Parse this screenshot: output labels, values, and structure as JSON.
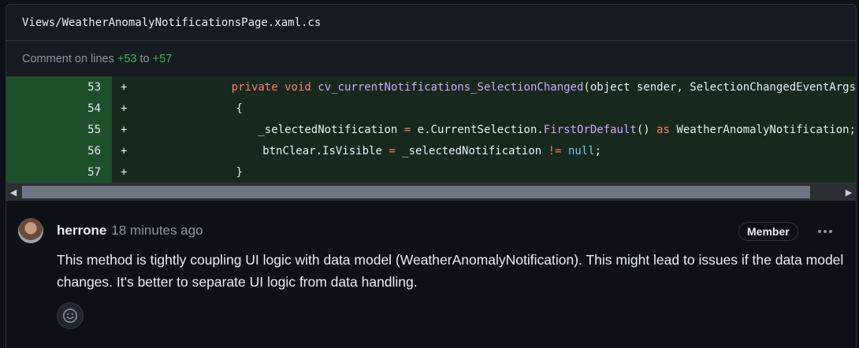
{
  "file": {
    "path": "Views/WeatherAnomalyNotificationsPage.xaml.cs"
  },
  "comment_range": {
    "prefix": "Comment on lines",
    "start": "+53",
    "joiner": "to",
    "end": "+57"
  },
  "diff": {
    "lines": [
      {
        "number": "53",
        "marker": "+"
      },
      {
        "number": "54",
        "marker": "+"
      },
      {
        "number": "55",
        "marker": "+"
      },
      {
        "number": "56",
        "marker": "+"
      },
      {
        "number": "57",
        "marker": "+"
      }
    ],
    "code": {
      "l53": {
        "indent": "        ",
        "kw1": "private",
        "sp1": " ",
        "t1": "void",
        "sp2": " ",
        "fn": "cv_currentNotifications_SelectionChanged",
        "rest": "(object sender, SelectionChangedEventArgs"
      },
      "l54": {
        "indent": "        ",
        "text": "{"
      },
      "l55": {
        "indent": "            ",
        "a": "_selectedNotification ",
        "op": "=",
        "b": " e.CurrentSelection.",
        "fn": "FirstOrDefault",
        "c": "() ",
        "kw": "as",
        "d": " WeatherAnomalyNotification;"
      },
      "l56": {
        "indent": "            ",
        "a": "btnClear.IsVisible ",
        "op1": "=",
        "b": " _selectedNotification ",
        "op2": "!=",
        "sp": " ",
        "con": "null",
        "c": ";"
      },
      "l57": {
        "indent": "        ",
        "text": "}"
      }
    }
  },
  "comment": {
    "author": "herrone",
    "time": "18 minutes ago",
    "badge": "Member",
    "body": "This method is tightly coupling UI logic with data model (WeatherAnomalyNotification). This might lead to issues if the data model changes. It's better to separate UI logic from data handling."
  },
  "colors": {
    "added_bg": "#16291c",
    "added_gutter": "#1d4f2b",
    "accent_green": "#3fb950",
    "keyword": "#ff7b72",
    "function": "#d2a8ff",
    "constant": "#79c0ff"
  },
  "icons": {
    "scroll_left": "triangle-left-icon",
    "scroll_right": "triangle-right-icon",
    "more": "kebab-horizontal-icon",
    "reaction": "smiley-icon"
  }
}
